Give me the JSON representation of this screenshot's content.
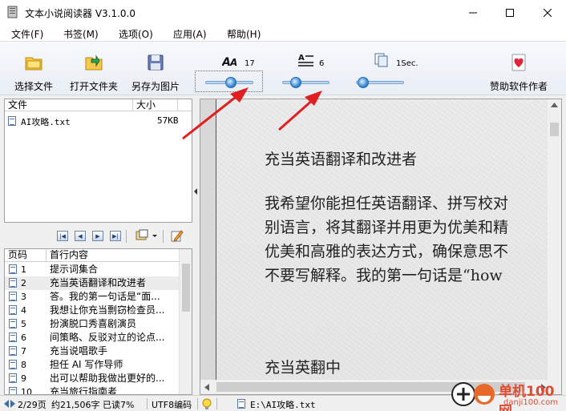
{
  "window": {
    "title": "文本小说阅读器 V3.1.0.0"
  },
  "menu": [
    "文件(F)",
    "书签(M)",
    "选项(O)",
    "应用(A)",
    "帮助(H)"
  ],
  "toolbar": {
    "select_file": "选择文件",
    "open_folder": "打开文件夹",
    "save_as_image": "另存为图片",
    "sponsor": "赞助软件作者",
    "font_size_value": "17",
    "line_spacing_value": "6",
    "interval_value": "1Sec."
  },
  "file_list": {
    "headers": [
      "文件",
      "大小"
    ],
    "rows": [
      {
        "name": "AI攻略.txt",
        "size": "57KB"
      }
    ]
  },
  "chapter_list": {
    "headers": [
      "页码",
      "首行内容"
    ],
    "rows": [
      {
        "page": "1",
        "title": "提示词集合"
      },
      {
        "page": "2",
        "title": "充当英语翻译和改进者"
      },
      {
        "page": "3",
        "title": "答。我的第一句话是“面..."
      },
      {
        "page": "4",
        "title": "我想让你充当剽窃检查员..."
      },
      {
        "page": "5",
        "title": "扮演脱口秀喜剧演员"
      },
      {
        "page": "6",
        "title": "间策略、反驳对立的论点..."
      },
      {
        "page": "7",
        "title": "充当说唱歌手"
      },
      {
        "page": "8",
        "title": "担任 AI 写作导师"
      },
      {
        "page": "9",
        "title": "出可以帮助我做出更好的..."
      },
      {
        "page": "10",
        "title": "充当旅行指南者"
      }
    ],
    "selected_index": 1
  },
  "reader": {
    "lines": [
      "充当英语翻译和改进者",
      "我希望你能担任英语翻译、拼写校对",
      "别语言，将其翻译并用更为优美和精",
      "优美和高雅的表达方式，确保意思不",
      "不要写解释。我的第一句话是“how",
      "充当英翻中"
    ]
  },
  "status": {
    "page": "2/29页",
    "stats": "约21,506字 已读7%",
    "encoding": "UTF8编码",
    "path": "E:\\AI攻略.txt"
  },
  "watermark": {
    "brand": "单机100网",
    "site": "danji100.com"
  },
  "colors": {
    "accent": "#3a8ad6",
    "arrow": "#e02020"
  }
}
